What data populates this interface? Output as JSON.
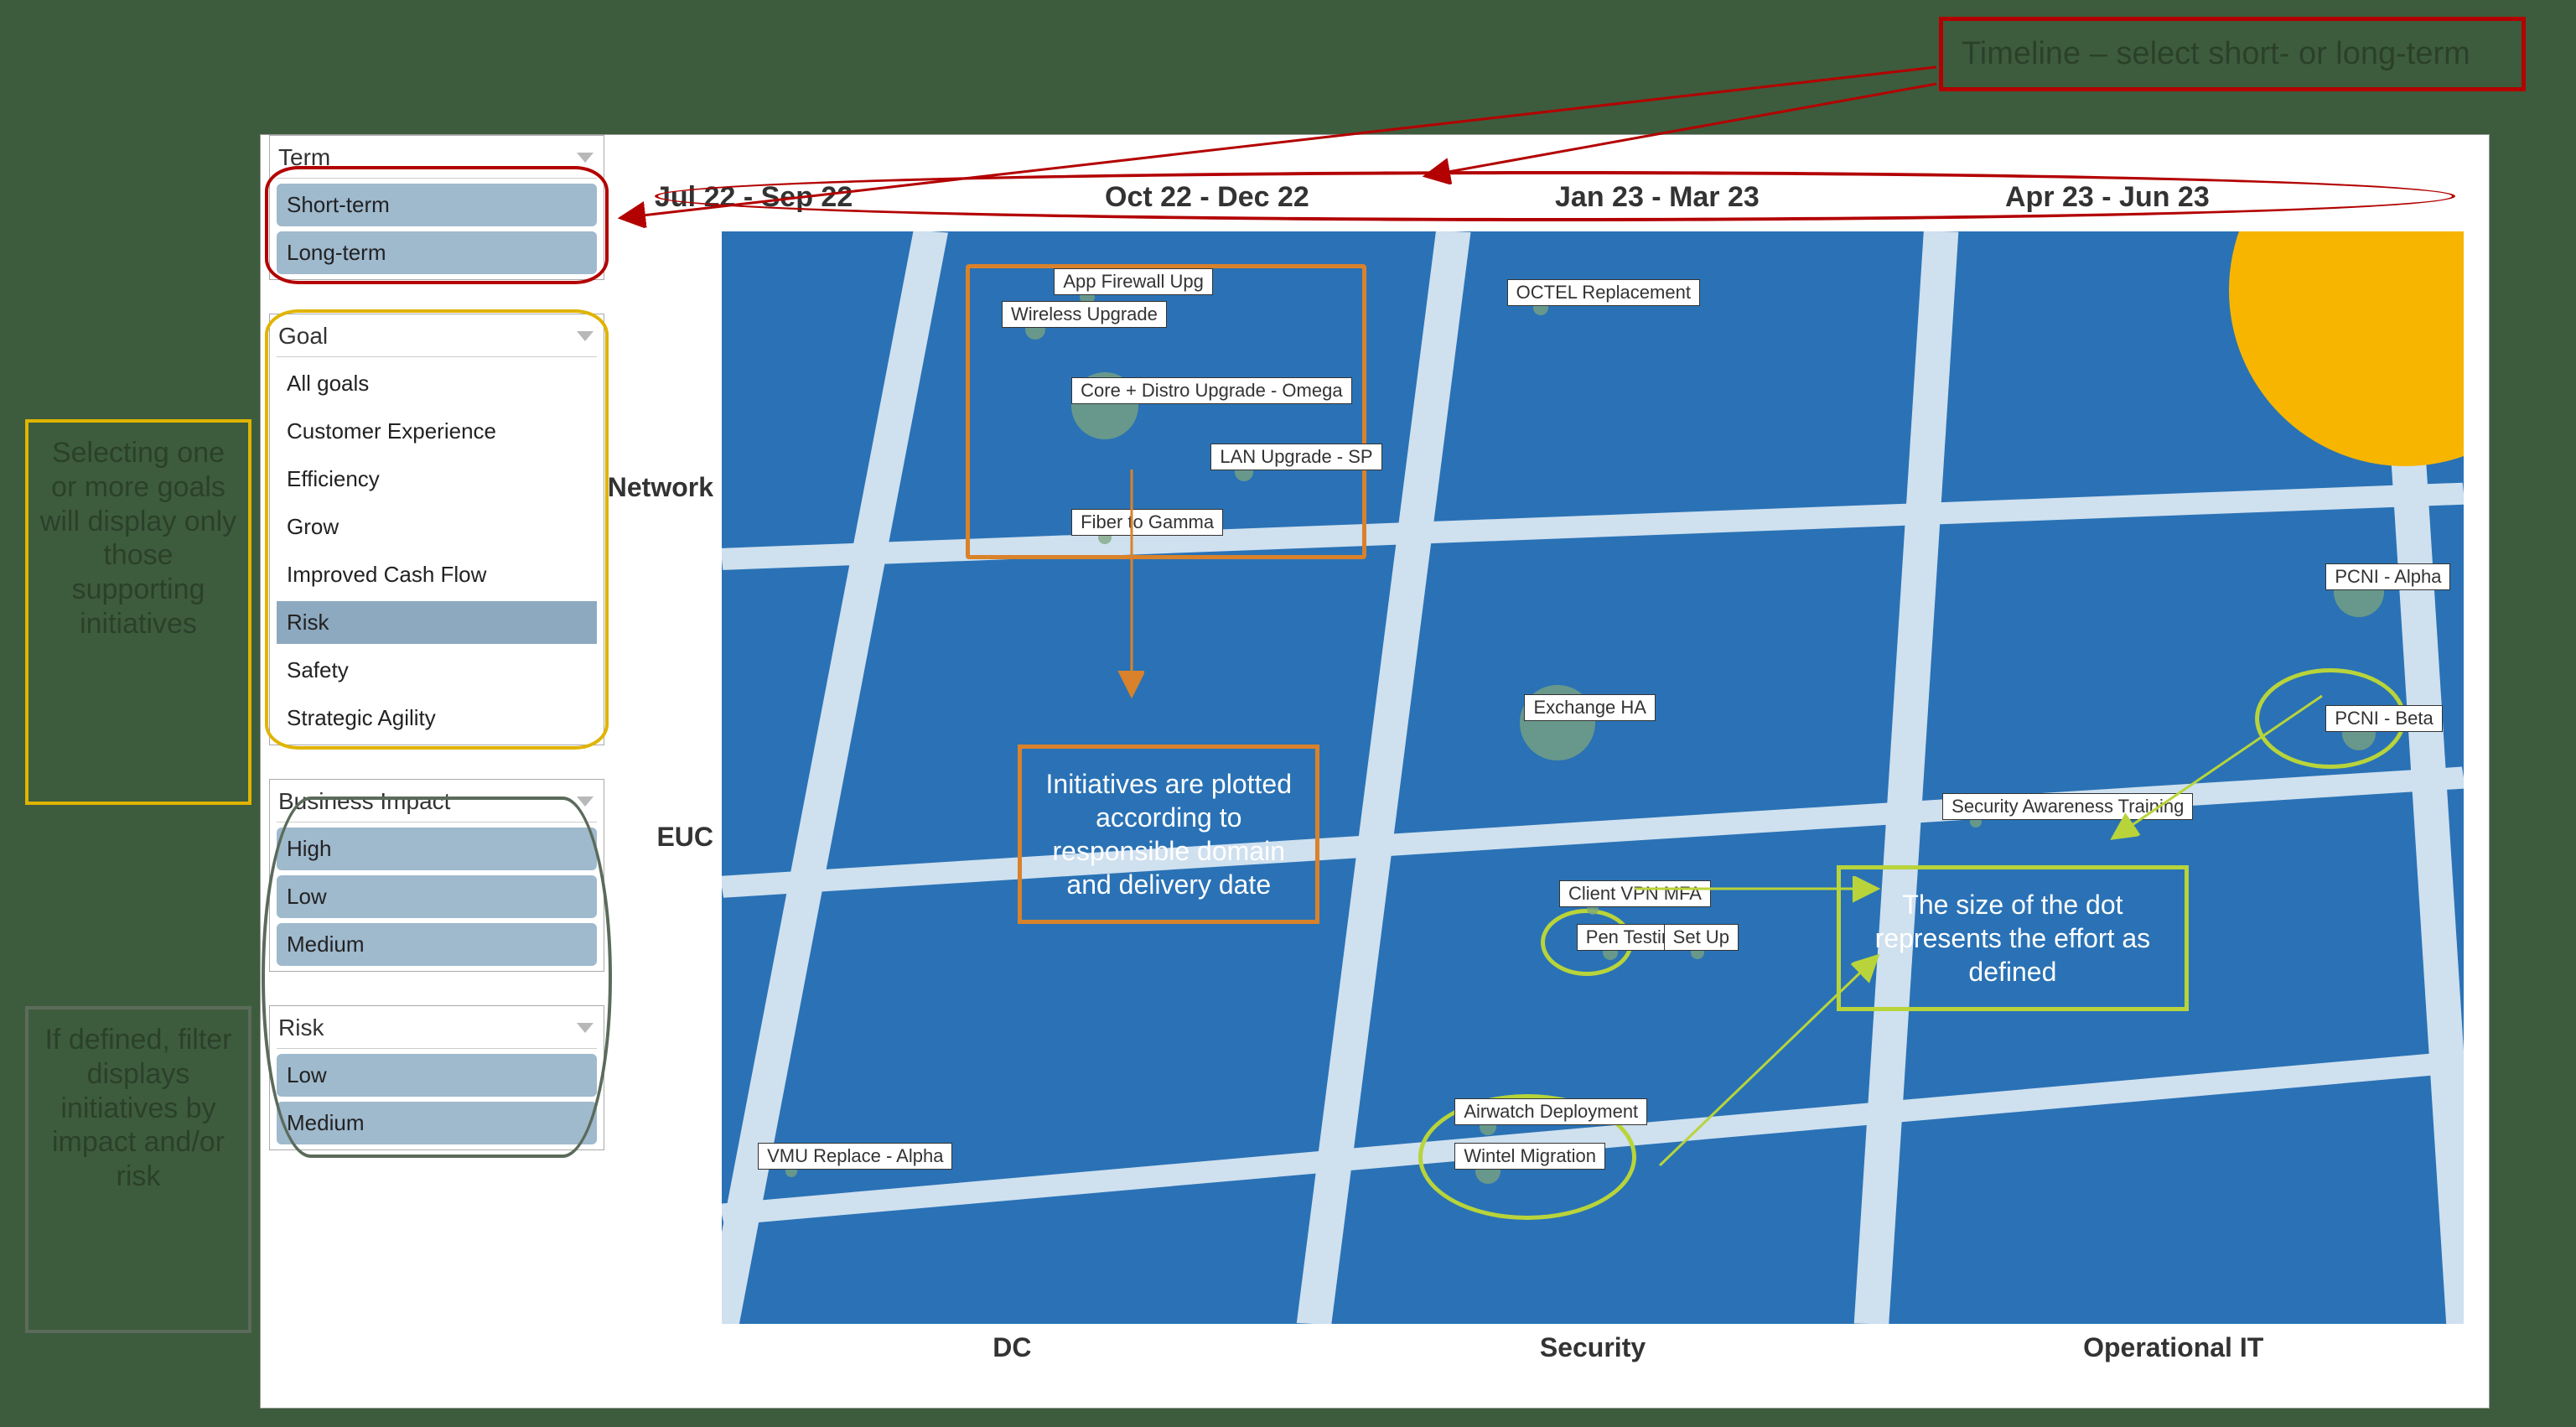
{
  "callouts": {
    "timeline": "Timeline – select short- or long-term",
    "goals_note": "Selecting one or more goals will display only those supporting initiatives",
    "impact_note": "If defined, filter displays initiatives by impact and/or risk",
    "plotted": "Initiatives are plotted according to responsible domain and delivery date",
    "dotsize": "The size of the dot represents the effort as defined"
  },
  "filters": {
    "term": {
      "title": "Term",
      "items": [
        "Short-term",
        "Long-term"
      ],
      "selected": [
        "Short-term",
        "Long-term"
      ]
    },
    "goal": {
      "title": "Goal",
      "items": [
        "All goals",
        "Customer Experience",
        "Efficiency",
        "Grow",
        "Improved Cash Flow",
        "Risk",
        "Safety",
        "Strategic Agility"
      ],
      "selected": [
        "Risk"
      ]
    },
    "impact": {
      "title": "Business Impact",
      "items": [
        "High",
        "Low",
        "Medium"
      ],
      "selected": [
        "High",
        "Low",
        "Medium"
      ]
    },
    "risk": {
      "title": "Risk",
      "items": [
        "Low",
        "Medium"
      ],
      "selected": [
        "Low",
        "Medium"
      ]
    }
  },
  "timeline": [
    "Jul 22 - Sep 22",
    "Oct 22 - Dec 22",
    "Jan 23 - Mar 23",
    "Apr 23 - Jun 23"
  ],
  "y_axis": [
    "Network",
    "EUC"
  ],
  "x_axis": [
    "DC",
    "Security",
    "Operational IT"
  ],
  "chart_data": {
    "type": "scatter",
    "x_dimension": "delivery_quarter",
    "y_dimension": "responsible_domain",
    "size_dimension": "effort",
    "x_categories": [
      "Jul 22 - Sep 22",
      "Oct 22 - Dec 22",
      "Jan 23 - Mar 23",
      "Apr 23 - Jun 23"
    ],
    "y_categories": [
      "Network",
      "EUC",
      "DC",
      "Security",
      "Operational IT"
    ],
    "initiatives": [
      {
        "name": "App Firewall Upg",
        "x_pct": 21,
        "y_pct": 6,
        "size": 18
      },
      {
        "name": "Wireless Upgrade",
        "x_pct": 18,
        "y_pct": 9,
        "size": 24
      },
      {
        "name": "Core + Distro Upgrade - Omega",
        "x_pct": 22,
        "y_pct": 16,
        "size": 80
      },
      {
        "name": "LAN Upgrade - SP",
        "x_pct": 30,
        "y_pct": 22,
        "size": 22
      },
      {
        "name": "Fiber to Gamma",
        "x_pct": 22,
        "y_pct": 28,
        "size": 16
      },
      {
        "name": "OCTEL Replacement",
        "x_pct": 47,
        "y_pct": 7,
        "size": 18
      },
      {
        "name": "Exchange HA",
        "x_pct": 48,
        "y_pct": 45,
        "size": 90
      },
      {
        "name": "Security Awareness Training",
        "x_pct": 72,
        "y_pct": 54,
        "size": 14
      },
      {
        "name": "Client VPN MFA",
        "x_pct": 50,
        "y_pct": 62,
        "size": 14
      },
      {
        "name": "Pen Testing",
        "x_pct": 51,
        "y_pct": 66,
        "size": 18
      },
      {
        "name": "Set Up",
        "x_pct": 56,
        "y_pct": 66,
        "size": 16
      },
      {
        "name": "Airwatch Deployment",
        "x_pct": 44,
        "y_pct": 82,
        "size": 20
      },
      {
        "name": "Wintel Migration",
        "x_pct": 44,
        "y_pct": 86,
        "size": 30
      },
      {
        "name": "VMU Replace - Alpha",
        "x_pct": 4,
        "y_pct": 86,
        "size": 14
      },
      {
        "name": "PCNI - Alpha",
        "x_pct": 94,
        "y_pct": 33,
        "size": 60
      },
      {
        "name": "PCNI - Beta",
        "x_pct": 94,
        "y_pct": 46,
        "size": 40
      }
    ]
  }
}
